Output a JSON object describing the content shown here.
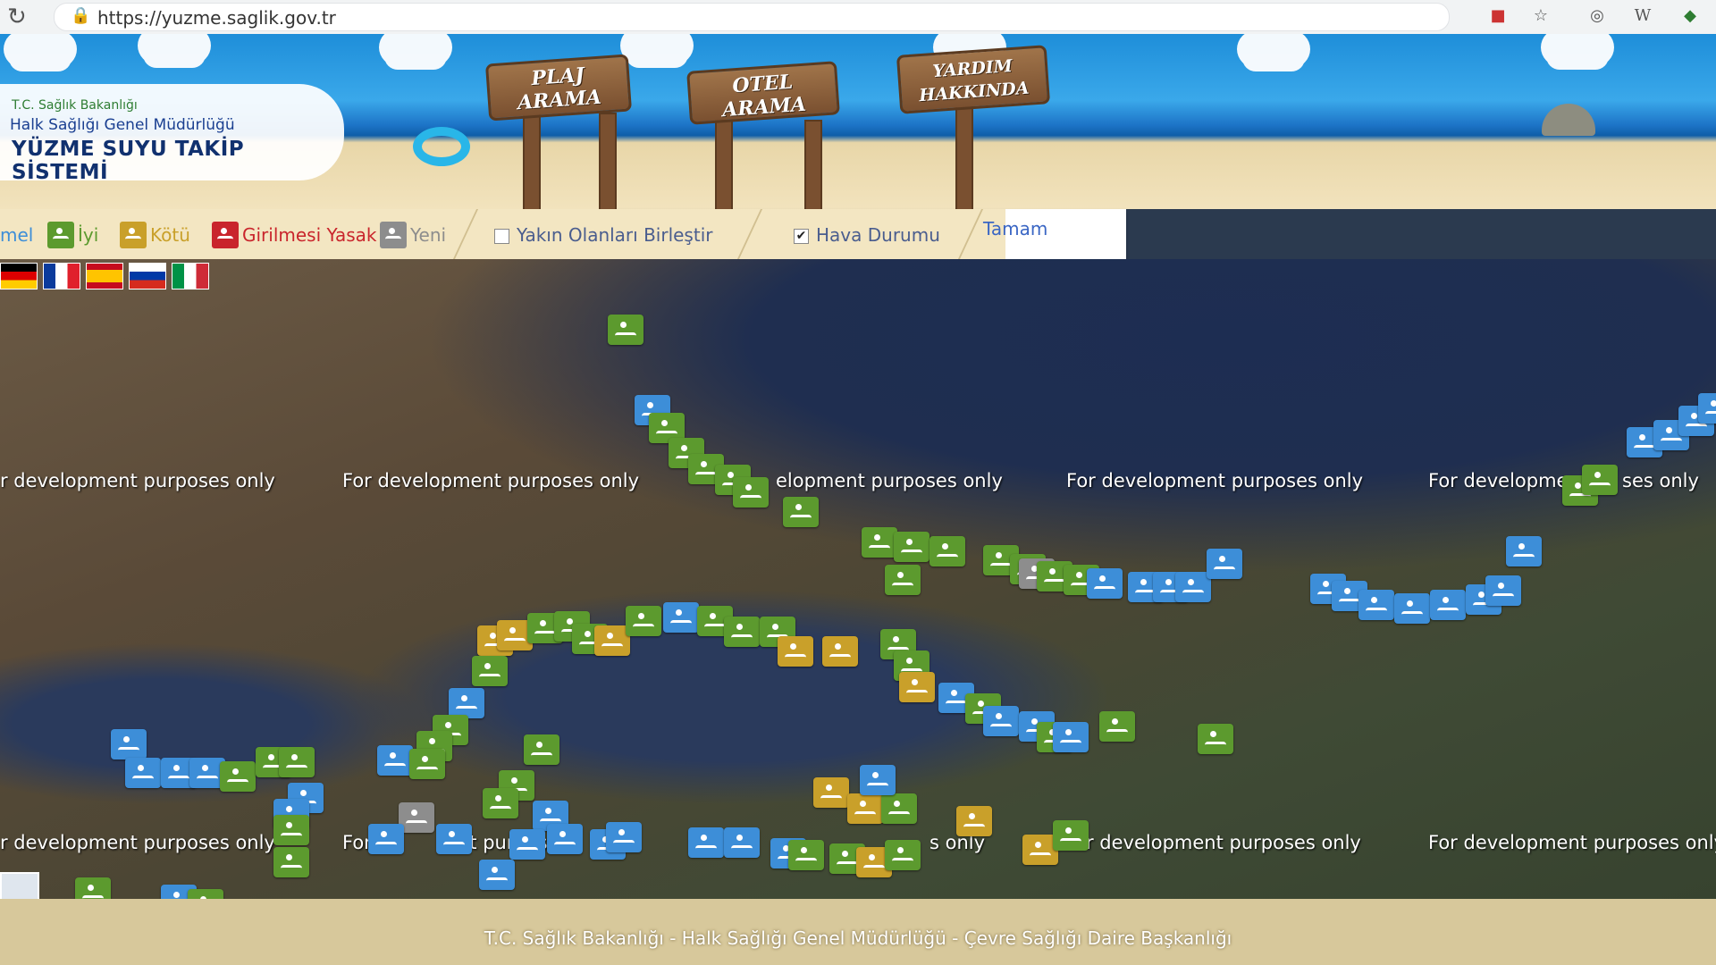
{
  "browser": {
    "url": "https://yuzme.saglik.gov.tr"
  },
  "brand": {
    "ministry": "T.C. Sağlık Bakanlığı",
    "directorate": "Halk Sağlığı Genel Müdürlüğü",
    "system": "YÜZME SUYU TAKİP SİSTEMİ"
  },
  "signs": {
    "beach_search": "PLAJ ARAMA",
    "hotel_search": "OTEL ARAMA",
    "about": "YARDIM HAKKINDA"
  },
  "legend": {
    "partial": "mel",
    "good": "İyi",
    "bad": "Kötü",
    "forbidden": "Girilmesi Yasak",
    "new": "Yeni",
    "colors": {
      "good": "#5c9a2e",
      "bad": "#c9a02a",
      "forbidden": "#c9252c",
      "new": "#8d8d8d",
      "unknown": "#3d8ed8"
    }
  },
  "options": {
    "merge_nearby": "Yakın Olanları Birleştir",
    "merge_nearby_checked": false,
    "weather": "Hava Durumu",
    "weather_checked": true,
    "ok": "Tamam"
  },
  "languages": [
    "Deutsch",
    "Français",
    "Español",
    "Русский",
    "Italiano"
  ],
  "map": {
    "watermark": "For development purposes only",
    "watermarks_row1": [
      "r development purposes only",
      "For development purposes only",
      "elopment purposes only",
      "For development purposes only",
      "For developme",
      "ses only"
    ],
    "watermarks_row2": [
      "r development purposes only",
      "For",
      "nt purpos",
      "s only",
      "r development purposes only",
      "For development purposes only"
    ]
  },
  "footer": {
    "text": "T.C. Sağlık Bakanlığı - Halk Sağlığı Genel Müdürlüğü - Çevre Sağlığı Daire Başkanlığı"
  }
}
